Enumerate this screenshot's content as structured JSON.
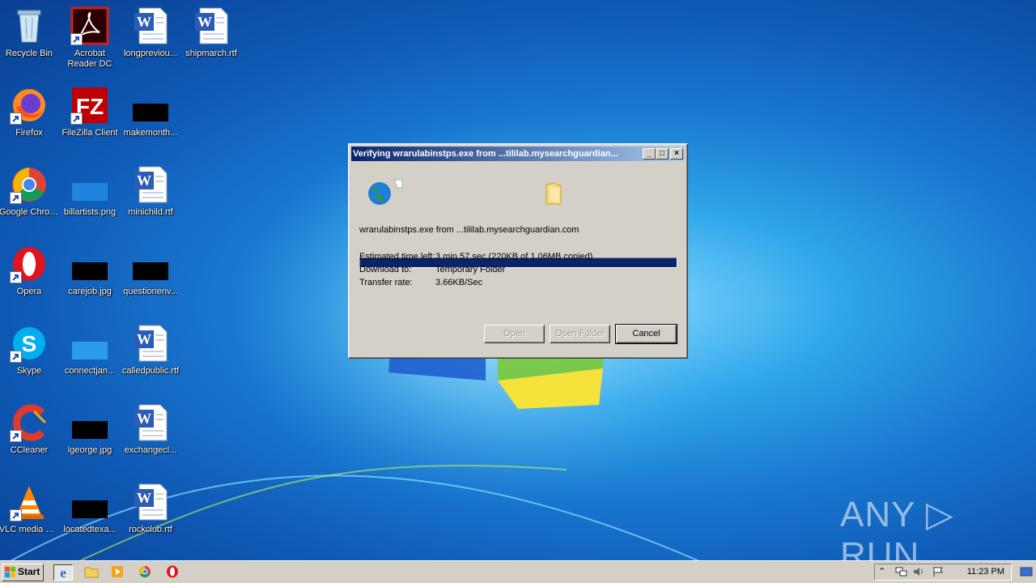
{
  "desktop": {
    "icons": [
      {
        "label": "Recycle Bin"
      },
      {
        "label": "Acrobat Reader DC"
      },
      {
        "label": "longpreviou..."
      },
      {
        "label": "shipmarch.rtf"
      },
      {
        "label": "Firefox"
      },
      {
        "label": "FileZilla Client"
      },
      {
        "label": "makemonth..."
      },
      {
        "label": "Google Chrome"
      },
      {
        "label": "billartists.png"
      },
      {
        "label": "minichild.rtf"
      },
      {
        "label": "Opera"
      },
      {
        "label": "carejob.jpg"
      },
      {
        "label": "questionenv..."
      },
      {
        "label": "Skype"
      },
      {
        "label": "connectjan..."
      },
      {
        "label": "calledpublic.rtf"
      },
      {
        "label": "CCleaner"
      },
      {
        "label": "lgeorge.jpg"
      },
      {
        "label": "exchangecl..."
      },
      {
        "label": "VLC media player"
      },
      {
        "label": "locatedtexa..."
      },
      {
        "label": "rockclub.rtf"
      }
    ]
  },
  "dialog": {
    "title": "Verifying wrarulabinstps.exe from ...tililab.mysearchguardian...",
    "file_line": "wrarulabinstps.exe from ...tililab.mysearchguardian.com",
    "progress": 1.0,
    "rows": [
      {
        "label": "Estimated time left:",
        "value": "3 min 57 sec (220KB of 1.06MB copied)"
      },
      {
        "label": "Download to:",
        "value": "Temporary Folder"
      },
      {
        "label": "Transfer rate:",
        "value": "3.66KB/Sec"
      }
    ],
    "buttons": {
      "open": "Open",
      "open_folder": "Open Folder",
      "cancel": "Cancel"
    },
    "icons": {
      "source": "globe-icon",
      "destination": "folder-icon"
    }
  },
  "taskbar": {
    "start_label": "Start",
    "clock": "11:23 PM",
    "quick_launch": [
      "internet-explorer-icon",
      "explorer-folder-icon",
      "media-player-icon",
      "chrome-icon",
      "opera-icon"
    ]
  },
  "watermark": "ANY ▷ RUN"
}
